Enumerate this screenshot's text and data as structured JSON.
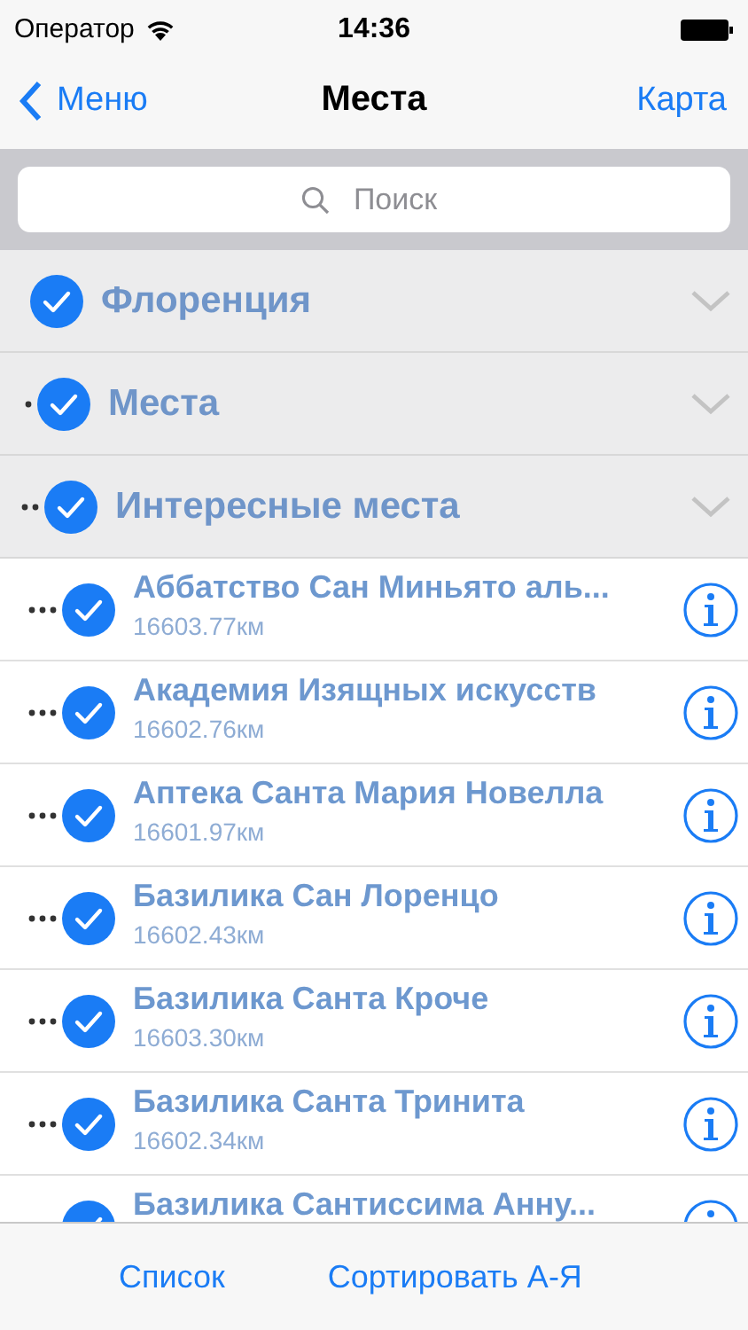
{
  "status_bar": {
    "carrier": "Оператор",
    "time": "14:36"
  },
  "nav": {
    "back": "Меню",
    "title": "Места",
    "action": "Карта"
  },
  "search": {
    "placeholder": "Поиск"
  },
  "tree": [
    {
      "title": "Флоренция",
      "checked": true,
      "children": [
        {
          "title": "Места",
          "checked": true,
          "children": [
            {
              "title": "Интересные места",
              "checked": true,
              "children": [
                {
                  "name": "Аббатство Сан Миньято аль...",
                  "distance": "16603.77км",
                  "checked": true
                },
                {
                  "name": "Академия Изящных искусств",
                  "distance": "16602.76км",
                  "checked": true
                },
                {
                  "name": "Аптека Санта Мария Новелла",
                  "distance": "16601.97км",
                  "checked": true
                },
                {
                  "name": "Базилика Сан Лоренцо",
                  "distance": "16602.43км",
                  "checked": true
                },
                {
                  "name": "Базилика Санта Кроче",
                  "distance": "16603.30км",
                  "checked": true
                },
                {
                  "name": "Базилика Санта Тринита",
                  "distance": "16602.34км",
                  "checked": true
                },
                {
                  "name": "Базилика Сантиссима Анну...",
                  "checked": true
                }
              ]
            }
          ]
        }
      ]
    }
  ],
  "toolbar": [
    "Список",
    "Сортировать А-Я"
  ]
}
